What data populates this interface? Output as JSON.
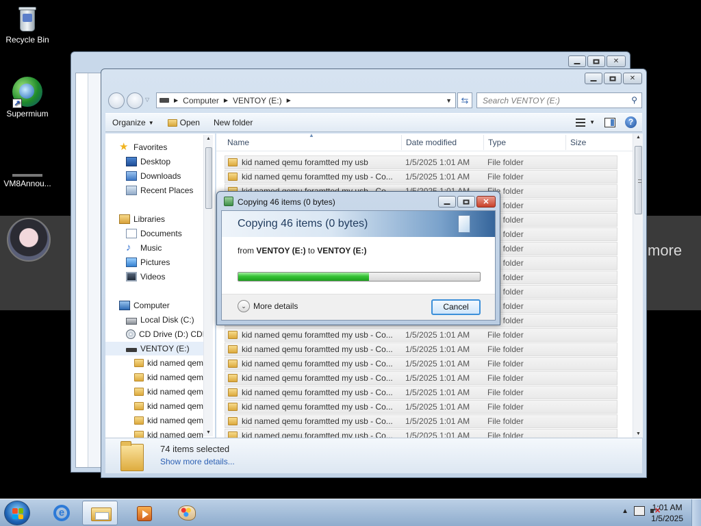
{
  "desktop": {
    "icons": [
      {
        "label": "Recycle Bin",
        "icon": "recycle-bin-icon"
      },
      {
        "label": "Supermium",
        "icon": "supermium-icon"
      },
      {
        "label": "VM8Annou...",
        "icon": "vm8-icon"
      }
    ],
    "background_overlay_text": "more"
  },
  "explorer": {
    "address": {
      "root": "Computer",
      "drive": "VENTOY (E:)"
    },
    "search_placeholder": "Search VENTOY (E:)",
    "toolbar": {
      "organize": "Organize",
      "open": "Open",
      "new_folder": "New folder"
    },
    "nav": {
      "favorites": "Favorites",
      "desktop": "Desktop",
      "downloads": "Downloads",
      "recent": "Recent Places",
      "libraries": "Libraries",
      "documents": "Documents",
      "music": "Music",
      "pictures": "Pictures",
      "videos": "Videos",
      "computer": "Computer",
      "local_disk": "Local Disk (C:)",
      "cd_drive": "CD Drive (D:) CDI",
      "ventoy": "VENTOY (E:)",
      "subfolders": [
        "kid named qem",
        "kid named qem",
        "kid named qem",
        "kid named qem",
        "kid named qem",
        "kid named qem"
      ]
    },
    "columns": {
      "name": "Name",
      "date": "Date modified",
      "type": "Type",
      "size": "Size"
    },
    "files": [
      {
        "name": "kid named qemu foramtted my usb",
        "date": "1/5/2025 1:01 AM",
        "type": "File folder"
      },
      {
        "name": "kid named qemu foramtted my usb - Co...",
        "date": "1/5/2025 1:01 AM",
        "type": "File folder"
      },
      {
        "name": "kid named qemu foramtted my usb - Co...",
        "date": "1/5/2025 1:01 AM",
        "type": "File folder"
      },
      {
        "name": "kid named qemu foramtted my usb - Co...",
        "date": "1/5/2025 1:01 AM",
        "type": "File folder"
      },
      {
        "name": "kid named qemu foramtted my usb - Co...",
        "date": "1/5/2025 1:01 AM",
        "type": "File folder"
      },
      {
        "name": "kid named qemu foramtted my usb - Co...",
        "date": "1/5/2025 1:01 AM",
        "type": "File folder"
      },
      {
        "name": "kid named qemu foramtted my usb - Co...",
        "date": "1/5/2025 1:01 AM",
        "type": "File folder"
      },
      {
        "name": "kid named qemu foramtted my usb - Co...",
        "date": "1/5/2025 1:01 AM",
        "type": "File folder"
      },
      {
        "name": "kid named qemu foramtted my usb - Co...",
        "date": "1/5/2025 1:01 AM",
        "type": "File folder"
      },
      {
        "name": "kid named qemu foramtted my usb - Co...",
        "date": "1/5/2025 1:01 AM",
        "type": "File folder"
      },
      {
        "name": "kid named qemu foramtted my usb - Co...",
        "date": "1/5/2025 1:01 AM",
        "type": "File folder"
      },
      {
        "name": "kid named qemu foramtted my usb - Co...",
        "date": "1/5/2025 1:01 AM",
        "type": "File folder"
      },
      {
        "name": "kid named qemu foramtted my usb - Co...",
        "date": "1/5/2025 1:01 AM",
        "type": "File folder"
      },
      {
        "name": "kid named qemu foramtted my usb - Co...",
        "date": "1/5/2025 1:01 AM",
        "type": "File folder"
      },
      {
        "name": "kid named qemu foramtted my usb - Co...",
        "date": "1/5/2025 1:01 AM",
        "type": "File folder"
      },
      {
        "name": "kid named qemu foramtted my usb - Co...",
        "date": "1/5/2025 1:01 AM",
        "type": "File folder"
      },
      {
        "name": "kid named qemu foramtted my usb - Co...",
        "date": "1/5/2025 1:01 AM",
        "type": "File folder"
      },
      {
        "name": "kid named qemu foramtted my usb - Co...",
        "date": "1/5/2025 1:01 AM",
        "type": "File folder"
      },
      {
        "name": "kid named qemu foramtted my usb - Co...",
        "date": "1/5/2025 1:01 AM",
        "type": "File folder"
      },
      {
        "name": "kid named qemu foramtted my usb - Co...",
        "date": "1/5/2025 1:01 AM",
        "type": "File folder"
      }
    ],
    "details": {
      "count": "74 items selected",
      "link": "Show more details..."
    }
  },
  "copy_dialog": {
    "title": "Copying 46 items (0 bytes)",
    "heading": "Copying 46 items (0 bytes)",
    "from_prefix": "from",
    "source": "VENTOY (E:)",
    "to_word": "to",
    "destination": "VENTOY (E:)",
    "progress_fraction": 0.54,
    "more_details": "More details",
    "cancel": "Cancel",
    "progress_color": "#36c336"
  },
  "taskbar": {
    "pinned": [
      "internet-explorer-icon",
      "windows-explorer-icon",
      "media-player-icon",
      "paint-icon"
    ],
    "time": "1:01 AM",
    "date": "1/5/2025"
  }
}
